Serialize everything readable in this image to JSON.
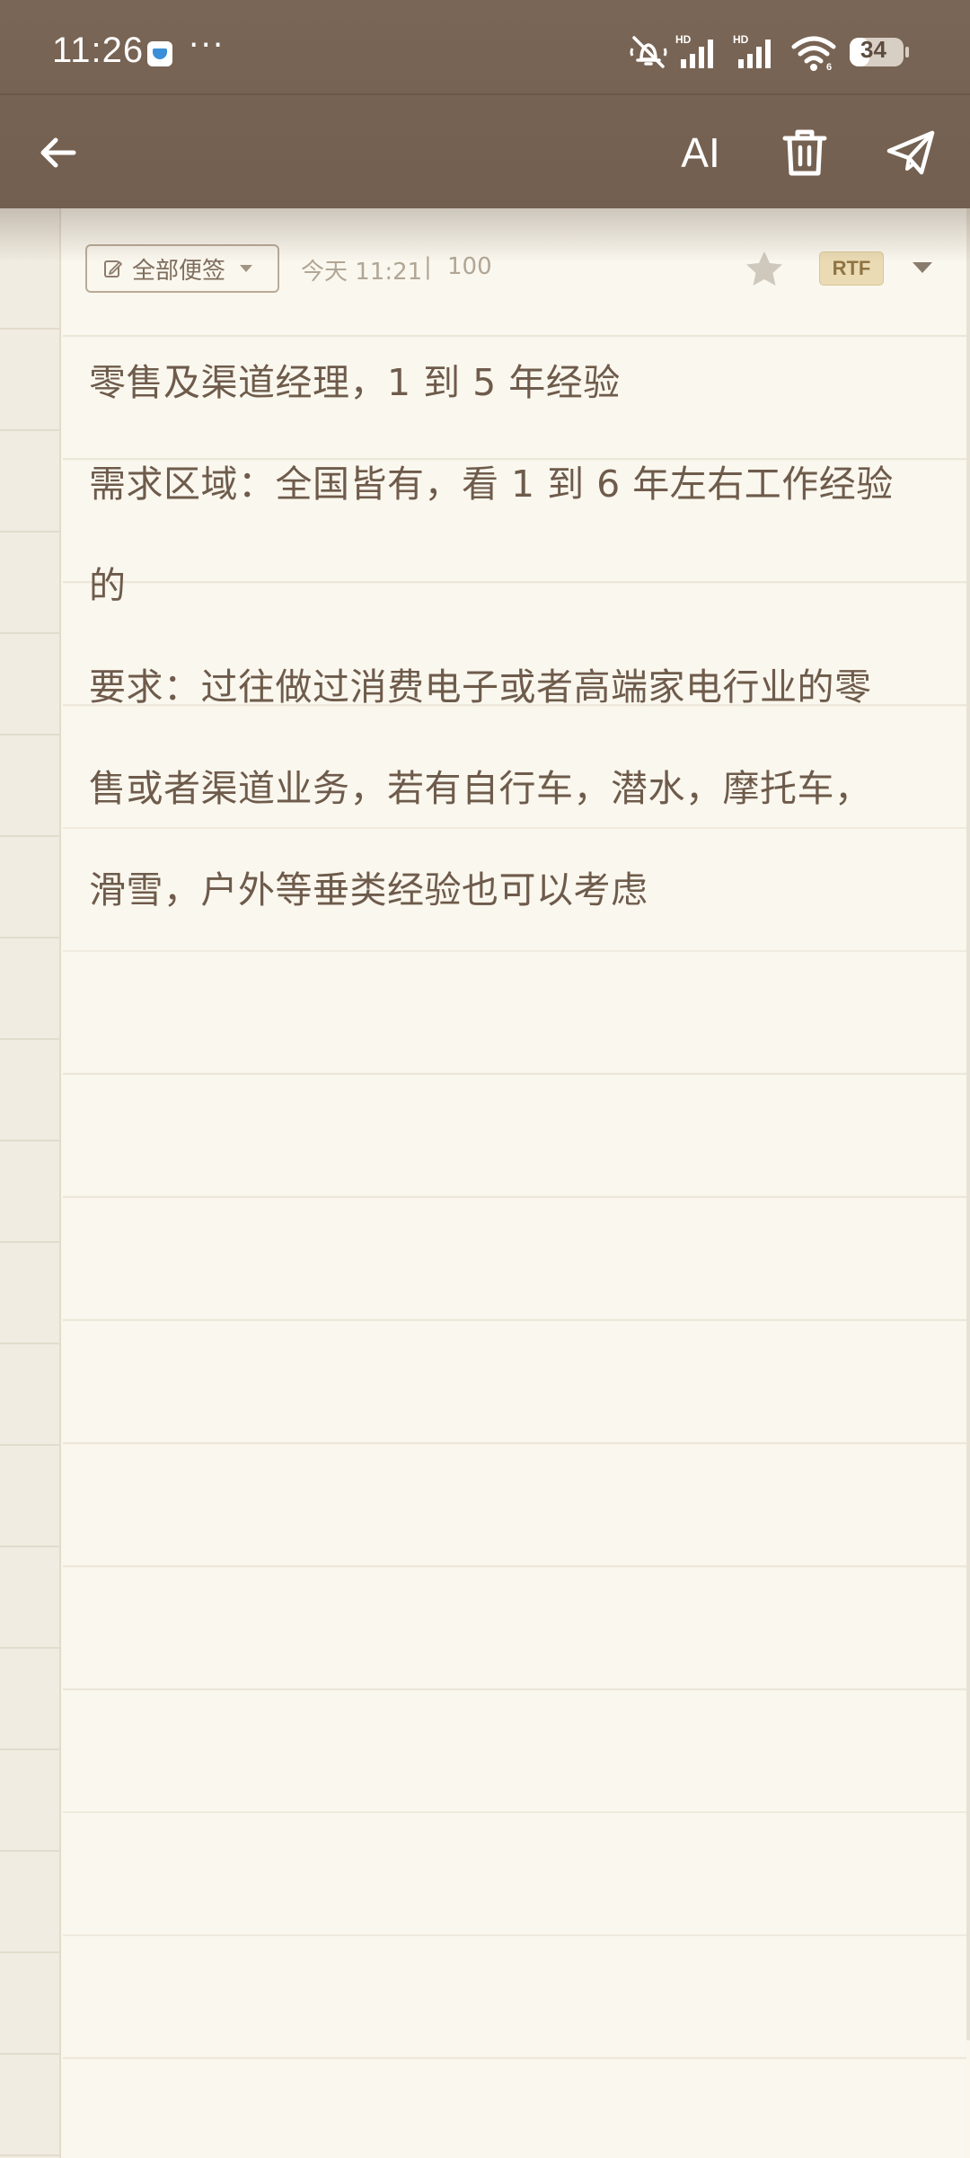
{
  "status_bar": {
    "time": "11:26",
    "dots": "···",
    "battery": "34"
  },
  "toolbar": {
    "ai_label": "AI"
  },
  "meta": {
    "folder_label": "全部便签",
    "date": "今天 11:21",
    "separator": "|",
    "word_count": "100",
    "format_badge": "RTF"
  },
  "note": {
    "lines": [
      "零售及渠道经理，1 到 5 年经验",
      "需求区域：全国皆有，看 1 到 6 年左右工作经验",
      "的",
      "要求：过往做过消费电子或者高端家电行业的零",
      "售或者渠道业务，若有自行车，潜水，摩托车，",
      "滑雪，户外等垂类经验也可以考虑"
    ]
  },
  "colors": {
    "chrome": "#7a6656",
    "paper": "#faf7ee",
    "text": "#6e5b4b",
    "meta_text": "#b1a696",
    "badge_bg": "#eadbb4"
  }
}
